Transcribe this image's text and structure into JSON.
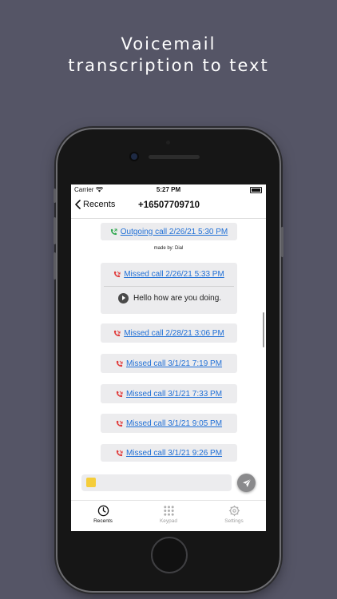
{
  "headline": {
    "line1": "Voicemail",
    "line2": "transcription to text"
  },
  "status_bar": {
    "carrier": "Carrier",
    "time": "5:27 PM",
    "icons": [
      "wifi-icon",
      "battery-icon"
    ]
  },
  "nav": {
    "back_label": "Recents",
    "title": "+16507709710"
  },
  "messages": [
    {
      "type": "outgoing",
      "label": "Outgoing call 2/26/21  5:30 PM",
      "icon": "phone-outgoing-icon",
      "color": "#2fa84f"
    },
    {
      "type": "missed_voicemail",
      "label": "Missed call 2/26/21  5:33 PM",
      "icon": "phone-missed-icon",
      "color": "#e03a3a",
      "transcription": "Hello how are you doing."
    },
    {
      "type": "missed",
      "label": "Missed call 2/28/21  3:06 PM",
      "icon": "phone-missed-icon",
      "color": "#e03a3a"
    },
    {
      "type": "missed",
      "label": "Missed call 3/1/21  7:19 PM",
      "icon": "phone-missed-icon",
      "color": "#e03a3a"
    },
    {
      "type": "missed",
      "label": "Missed call 3/1/21  7:33 PM",
      "icon": "phone-missed-icon",
      "color": "#e03a3a"
    },
    {
      "type": "missed",
      "label": "Missed call 3/1/21  9:05 PM",
      "icon": "phone-missed-icon",
      "color": "#e03a3a"
    },
    {
      "type": "missed",
      "label": "Missed call 3/1/21  9:26 PM",
      "icon": "phone-missed-icon",
      "color": "#e03a3a"
    }
  ],
  "made_by": "made by: Dial",
  "composer": {
    "value": "",
    "sticker_icon": "sticky-note-icon",
    "send_icon": "send-icon"
  },
  "tabs": [
    {
      "label": "Recents",
      "icon": "clock-icon",
      "active": true
    },
    {
      "label": "Keypad",
      "icon": "keypad-icon",
      "active": false
    },
    {
      "label": "Settings",
      "icon": "gear-icon",
      "active": false
    }
  ],
  "colors": {
    "background": "#555566",
    "link": "#1f6fd6",
    "bubble": "#ececee",
    "outgoing_icon": "#2fa84f",
    "missed_icon": "#e03a3a"
  }
}
